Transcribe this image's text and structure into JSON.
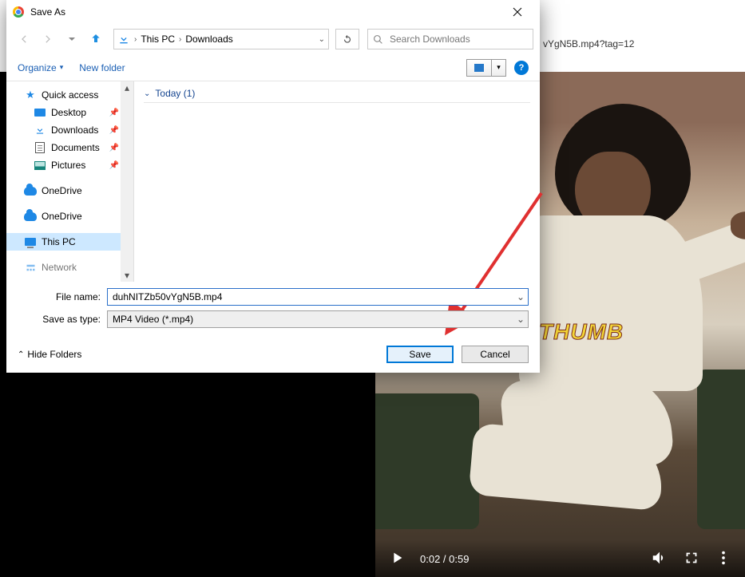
{
  "browser": {
    "url_fragment": "vYgN5B.mp4?tag=12"
  },
  "dialog": {
    "title": "Save As",
    "breadcrumb": {
      "root": "This PC",
      "folder": "Downloads"
    },
    "search_placeholder": "Search Downloads",
    "toolbar": {
      "organize": "Organize",
      "new_folder": "New folder"
    },
    "sidebar": {
      "quick_access": "Quick access",
      "desktop": "Desktop",
      "downloads": "Downloads",
      "documents": "Documents",
      "pictures": "Pictures",
      "onedrive1": "OneDrive",
      "onedrive2": "OneDrive",
      "this_pc": "This PC",
      "network": "Network"
    },
    "content": {
      "group_today": "Today (1)"
    },
    "filename_label": "File name:",
    "filename_value": "duhNITZb50vYgN5B.mp4",
    "type_label": "Save as type:",
    "type_value": "MP4 Video (*.mp4)",
    "hide_folders": "Hide Folders",
    "save": "Save",
    "cancel": "Cancel"
  },
  "video": {
    "caption": "THUMB",
    "time": "0:02 / 0:59"
  }
}
